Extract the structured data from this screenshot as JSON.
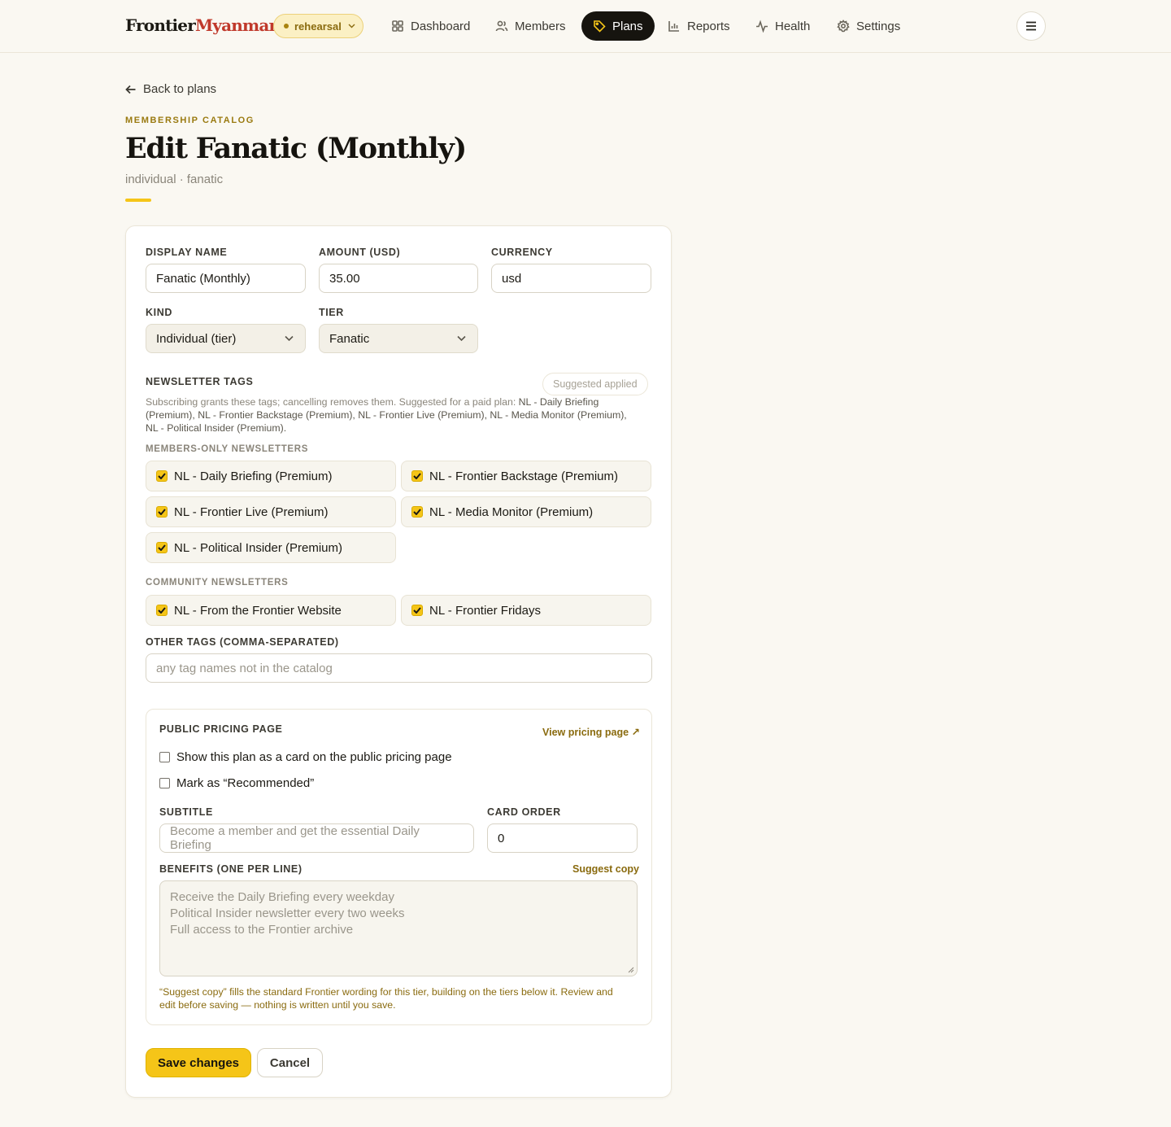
{
  "brand": {
    "part1": "Frontier",
    "part2": "Myanmar"
  },
  "env": {
    "label": "rehearsal"
  },
  "nav": {
    "dashboard": "Dashboard",
    "members": "Members",
    "plans": "Plans",
    "reports": "Reports",
    "health": "Health",
    "settings": "Settings"
  },
  "page": {
    "back": "Back to plans",
    "eyebrow": "MEMBERSHIP CATALOG",
    "title": "Edit Fanatic (Monthly)",
    "subtitle": "individual · fanatic"
  },
  "form": {
    "display_name": {
      "label": "DISPLAY NAME",
      "value": "Fanatic (Monthly)"
    },
    "amount": {
      "label": "AMOUNT (USD)",
      "value": "35.00"
    },
    "currency": {
      "label": "CURRENCY",
      "value": "usd"
    },
    "kind": {
      "label": "KIND",
      "value": "Individual (tier)"
    },
    "tier": {
      "label": "TIER",
      "value": "Fanatic"
    },
    "newsletter_tags": {
      "label": "NEWSLETTER TAGS",
      "suggested_badge": "Suggested applied",
      "help_prefix": "Subscribing grants these tags; cancelling removes them. Suggested for a paid plan: ",
      "help_line1_tail": "NL - Daily Briefing",
      "help_line2": "(Premium), NL - Frontier Backstage (Premium), NL - Frontier Live (Premium), NL - Media Monitor (Premium),",
      "help_line3": "NL - Political Insider (Premium)."
    },
    "members_only": {
      "label": "MEMBERS-ONLY NEWSLETTERS",
      "items": [
        {
          "label": "NL - Daily Briefing (Premium)",
          "checked": true
        },
        {
          "label": "NL - Frontier Backstage (Premium)",
          "checked": true
        },
        {
          "label": "NL - Frontier Live (Premium)",
          "checked": true
        },
        {
          "label": "NL - Media Monitor (Premium)",
          "checked": true
        },
        {
          "label": "NL - Political Insider (Premium)",
          "checked": true
        }
      ]
    },
    "community": {
      "label": "COMMUNITY NEWSLETTERS",
      "items": [
        {
          "label": "NL - From the Frontier Website",
          "checked": true
        },
        {
          "label": "NL - Frontier Fridays",
          "checked": true
        }
      ]
    },
    "other_tags": {
      "label": "OTHER TAGS (COMMA-SEPARATED)",
      "placeholder": "any tag names not in the catalog"
    },
    "pricing": {
      "label": "PUBLIC PRICING PAGE",
      "view_link": "View pricing page ↗",
      "show_card": {
        "label": "Show this plan as a card on the public pricing page",
        "checked": false
      },
      "recommended": {
        "label": "Mark as “Recommended”",
        "checked": false
      },
      "subtitle": {
        "label": "SUBTITLE",
        "placeholder": "Become a member and get the essential Daily Briefing"
      },
      "card_order": {
        "label": "CARD ORDER",
        "value": "0"
      },
      "benefits": {
        "label": "BENEFITS (ONE PER LINE)",
        "suggest": "Suggest copy",
        "placeholder_lines": [
          "Receive the Daily Briefing every weekday",
          "Political Insider newsletter every two weeks",
          "Full access to the Frontier archive"
        ]
      },
      "note_line1": "“Suggest copy” fills the standard Frontier wording for this tier, building on the tiers below it. Review and",
      "note_line2": "edit before saving — nothing is written until you save."
    },
    "save": "Save changes",
    "cancel": "Cancel"
  },
  "colors": {
    "accent": "#f5c518",
    "brand_red": "#c0392b",
    "gold_text": "#8a6b0f",
    "background": "#faf8f2"
  },
  "icons": [
    "grid-icon",
    "users-icon",
    "tag-icon",
    "bar-chart-icon",
    "pulse-icon",
    "gear-icon",
    "hamburger-icon",
    "arrow-left-icon",
    "chevron-down-icon",
    "check-icon"
  ]
}
